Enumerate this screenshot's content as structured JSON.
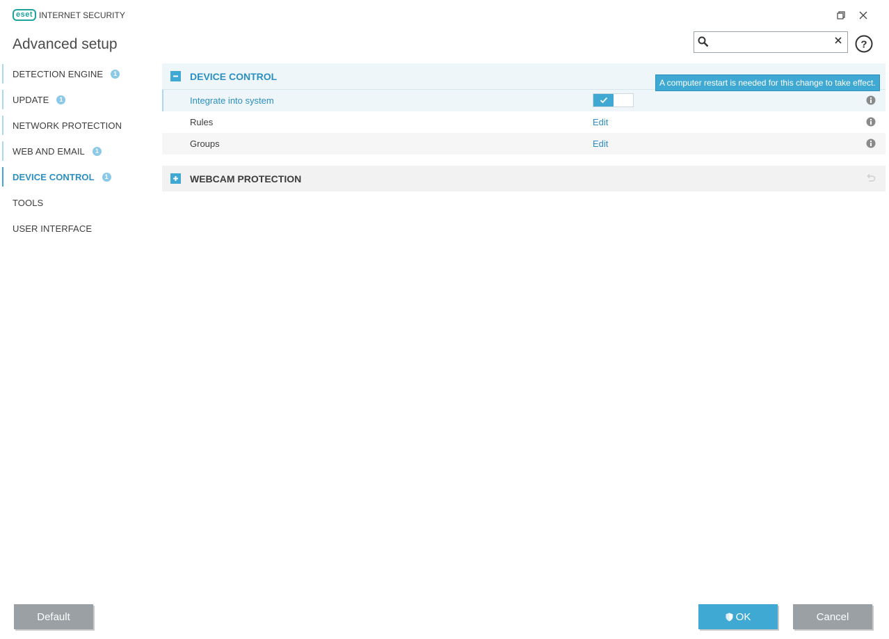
{
  "app": {
    "logo_badge": "eset",
    "product_name": "INTERNET SECURITY",
    "page_title": "Advanced setup"
  },
  "search": {
    "placeholder": "",
    "value": ""
  },
  "sidebar": {
    "items": [
      {
        "label": "DETECTION ENGINE",
        "badge": "1"
      },
      {
        "label": "UPDATE",
        "badge": "1"
      },
      {
        "label": "NETWORK PROTECTION",
        "badge": ""
      },
      {
        "label": "WEB AND EMAIL",
        "badge": "1"
      },
      {
        "label": "DEVICE CONTROL",
        "badge": "1",
        "active": true
      },
      {
        "label": "TOOLS",
        "badge": ""
      },
      {
        "label": "USER INTERFACE",
        "badge": ""
      }
    ]
  },
  "sections": {
    "device_control": {
      "title": "DEVICE CONTROL",
      "expanded": true,
      "rows": [
        {
          "label": "Integrate into system",
          "control": "toggle",
          "value": true
        },
        {
          "label": "Rules",
          "control": "link",
          "link_label": "Edit"
        },
        {
          "label": "Groups",
          "control": "link",
          "link_label": "Edit"
        }
      ]
    },
    "webcam": {
      "title": "WEBCAM PROTECTION",
      "expanded": false
    }
  },
  "tooltip": {
    "text": "A computer restart is needed for this change to take effect."
  },
  "footer": {
    "default_label": "Default",
    "ok_label": "OK",
    "cancel_label": "Cancel"
  },
  "colors": {
    "accent": "#3fa9d4",
    "text": "#3c3c3c",
    "button_gray": "#9aa0a4",
    "brand": "#1ba39c"
  }
}
